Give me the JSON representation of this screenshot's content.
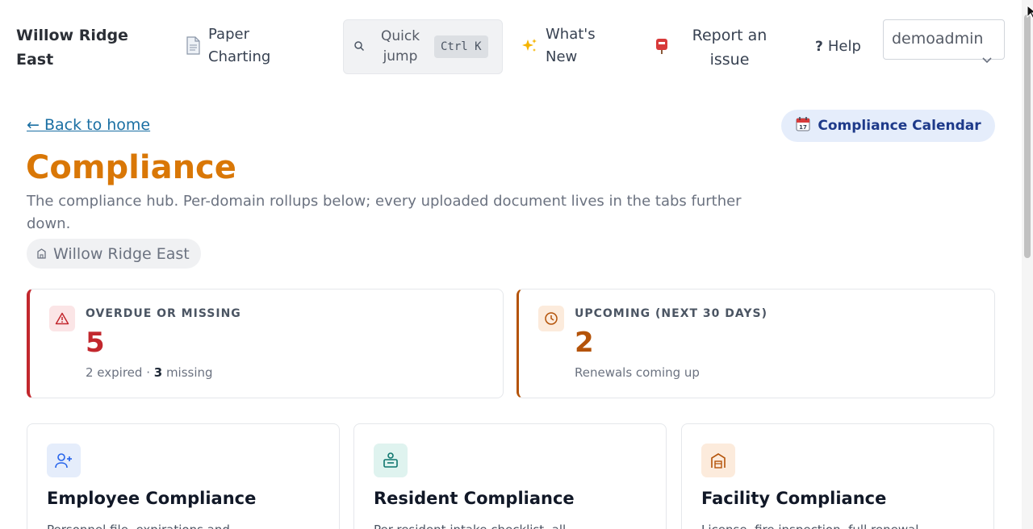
{
  "nav": {
    "brand": "Willow Ridge East",
    "paper_charting": "Paper Charting",
    "quick_jump": "Quick jump",
    "quick_jump_shortcut": "Ctrl K",
    "whats_new": "What's New",
    "report_issue": "Report an issue",
    "help": "Help",
    "user": "demoadmin"
  },
  "header": {
    "back_link": "← Back to home",
    "calendar_button": "Compliance Calendar",
    "title": "Compliance",
    "subtitle": "The compliance hub. Per-domain rollups below; every uploaded document lives in the tabs further down.",
    "facility": "Willow Ridge East"
  },
  "stats": {
    "overdue": {
      "label": "OVERDUE OR MISSING",
      "value": "5",
      "expired_text": "2 expired · ",
      "missing_count": "3",
      "missing_text": " missing"
    },
    "upcoming": {
      "label": "UPCOMING (NEXT 30 DAYS)",
      "value": "2",
      "note": "Renewals coming up"
    }
  },
  "domains": [
    {
      "title": "Employee Compliance",
      "desc": "Personnel file, expirations and..."
    },
    {
      "title": "Resident Compliance",
      "desc": "Per-resident intake checklist, all..."
    },
    {
      "title": "Facility Compliance",
      "desc": "License, fire inspection, full renewal..."
    }
  ],
  "colors": {
    "accent_title": "#d97706",
    "overdue": "#c2272d",
    "upcoming": "#b45309",
    "link": "#1a6fa3"
  }
}
